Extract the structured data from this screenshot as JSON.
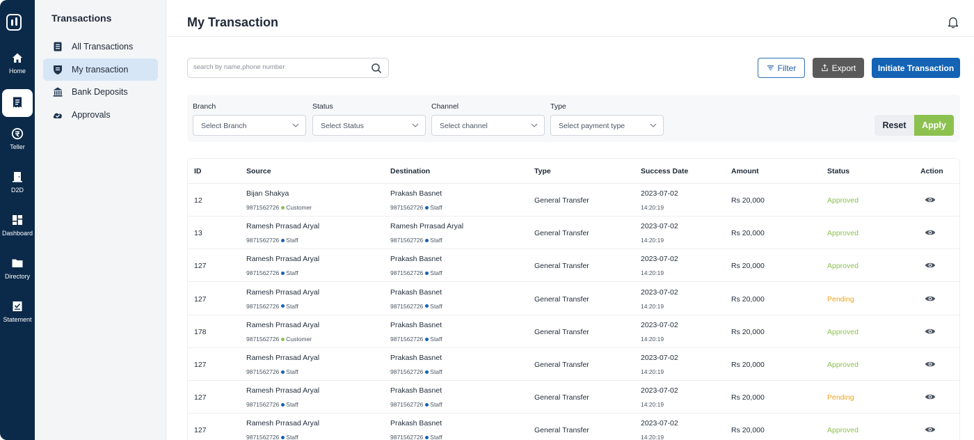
{
  "rail": {
    "items": [
      {
        "label": "Home",
        "icon": "home-icon"
      },
      {
        "label": "",
        "icon": "receipt-icon",
        "active": true
      },
      {
        "label": "Teller",
        "icon": "teller-icon"
      },
      {
        "label": "D2D",
        "icon": "door-icon"
      },
      {
        "label": "Dashboard",
        "icon": "dashboard-icon"
      },
      {
        "label": "Directory",
        "icon": "folder-icon"
      },
      {
        "label": "Statement",
        "icon": "statement-icon"
      }
    ]
  },
  "subside": {
    "title": "Transactions",
    "items": [
      {
        "label": "All Transactions",
        "icon": "list-icon"
      },
      {
        "label": "My transaction",
        "icon": "shield-icon",
        "active": true
      },
      {
        "label": "Bank Deposits",
        "icon": "bank-icon"
      },
      {
        "label": "Approvals",
        "icon": "check-cloud-icon"
      }
    ]
  },
  "header": {
    "title": "My Transaction"
  },
  "search": {
    "placeholder": "search by name,phone number"
  },
  "actions": {
    "filter": "Filter",
    "export": "Export",
    "initiate": "Initiate Transaction"
  },
  "filters": {
    "branch": {
      "label": "Branch",
      "placeholder": "Select Branch"
    },
    "status": {
      "label": "Status",
      "placeholder": "Select Status"
    },
    "channel": {
      "label": "Channel",
      "placeholder": "Select channel"
    },
    "type": {
      "label": "Type",
      "placeholder": "Select payment type"
    },
    "reset": "Reset",
    "apply": "Apply"
  },
  "table": {
    "columns": [
      "ID",
      "Source",
      "Destination",
      "Type",
      "Success Date",
      "Amount",
      "Status",
      "Action"
    ],
    "rows": [
      {
        "id": "12",
        "src_name": "Bijan Shakya",
        "src_phone": "9871562726",
        "src_role": "Customer",
        "dst_name": "Prakash Basnet",
        "dst_phone": "9871562726",
        "dst_role": "Staff",
        "type": "General Transfer",
        "date": "2023-07-02",
        "time": "14:20:19",
        "amount": "Rs 20,000",
        "status": "Approved"
      },
      {
        "id": "13",
        "src_name": "Ramesh Prrasad Aryal",
        "src_phone": "9871562726",
        "src_role": "Staff",
        "dst_name": "Ramesh Prrasad Aryal",
        "dst_phone": "9871562726",
        "dst_role": "Staff",
        "type": "General Transfer",
        "date": "2023-07-02",
        "time": "14:20:19",
        "amount": "Rs 20,000",
        "status": "Approved"
      },
      {
        "id": "127",
        "src_name": "Ramesh Prrasad Aryal",
        "src_phone": "9871562726",
        "src_role": "Staff",
        "dst_name": "Prakash Basnet",
        "dst_phone": "9871562726",
        "dst_role": "Staff",
        "type": "General Transfer",
        "date": "2023-07-02",
        "time": "14:20:19",
        "amount": "Rs 20,000",
        "status": "Approved"
      },
      {
        "id": "127",
        "src_name": "Ramesh Prrasad Aryal",
        "src_phone": "9871562726",
        "src_role": "Staff",
        "dst_name": "Prakash Basnet",
        "dst_phone": "9871562726",
        "dst_role": "Staff",
        "type": "General Transfer",
        "date": "2023-07-02",
        "time": "14:20:19",
        "amount": "Rs 20,000",
        "status": "Pending"
      },
      {
        "id": "178",
        "src_name": "Ramesh Prrasad Aryal",
        "src_phone": "9871562726",
        "src_role": "Customer",
        "dst_name": "Prakash Basnet",
        "dst_phone": "9871562726",
        "dst_role": "Staff",
        "type": "General Transfer",
        "date": "2023-07-02",
        "time": "14:20:19",
        "amount": "Rs 20,000",
        "status": "Approved"
      },
      {
        "id": "127",
        "src_name": "Ramesh Prrasad Aryal",
        "src_phone": "9871562726",
        "src_role": "Staff",
        "dst_name": "Prakash Basnet",
        "dst_phone": "9871562726",
        "dst_role": "Staff",
        "type": "General Transfer",
        "date": "2023-07-02",
        "time": "14:20:19",
        "amount": "Rs 20,000",
        "status": "Approved"
      },
      {
        "id": "127",
        "src_name": "Ramesh Prrasad Aryal",
        "src_phone": "9871562726",
        "src_role": "Staff",
        "dst_name": "Prakash Basnet",
        "dst_phone": "9871562726",
        "dst_role": "Staff",
        "type": "General Transfer",
        "date": "2023-07-02",
        "time": "14:20:19",
        "amount": "Rs 20,000",
        "status": "Pending"
      },
      {
        "id": "127",
        "src_name": "Ramesh Prrasad Aryal",
        "src_phone": "9871562726",
        "src_role": "Staff",
        "dst_name": "Prakash Basnet",
        "dst_phone": "9871562726",
        "dst_role": "Staff",
        "type": "General Transfer",
        "date": "2023-07-02",
        "time": "14:20:19",
        "amount": "Rs 20,000",
        "status": "Approved"
      }
    ]
  },
  "colors": {
    "primary": "#1463b5",
    "rail": "#0b2a4a",
    "approved": "#8cc14f",
    "pending": "#f0a21b",
    "staff_dot": "#1463b5",
    "customer_dot": "#8cc14f"
  }
}
